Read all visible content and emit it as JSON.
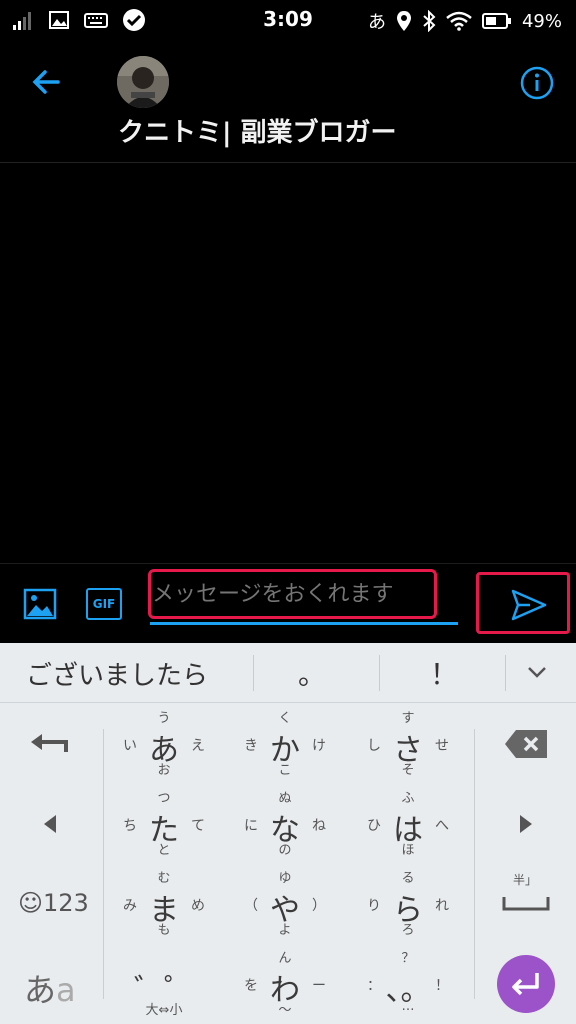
{
  "status": {
    "time": "3:09",
    "ime": "あ",
    "battery": "49%"
  },
  "header": {
    "title": "クニトミ| 副業ブロガー"
  },
  "composer": {
    "placeholder": "メッセージをおくれます",
    "gif_label": "GIF"
  },
  "keyboard": {
    "suggestion": "ございましたら",
    "suggest_items": [
      "。",
      "！"
    ],
    "rows": [
      [
        {
          "c": "あ",
          "u": "う",
          "d": "お",
          "l": "い",
          "r": "え"
        },
        {
          "c": "か",
          "u": "く",
          "d": "こ",
          "l": "き",
          "r": "け"
        },
        {
          "c": "さ",
          "u": "す",
          "d": "そ",
          "l": "し",
          "r": "せ"
        }
      ],
      [
        {
          "c": "た",
          "u": "つ",
          "d": "と",
          "l": "ち",
          "r": "て"
        },
        {
          "c": "な",
          "u": "ぬ",
          "d": "の",
          "l": "に",
          "r": "ね"
        },
        {
          "c": "は",
          "u": "ふ",
          "d": "ほ",
          "l": "ひ",
          "r": "へ"
        }
      ],
      [
        {
          "c": "ま",
          "u": "む",
          "d": "も",
          "l": "み",
          "r": "め"
        },
        {
          "c": "や",
          "u": "ゆ",
          "d": "よ",
          "l": "（",
          "r": "）"
        },
        {
          "c": "ら",
          "u": "る",
          "d": "ろ",
          "l": "り",
          "r": "れ"
        }
      ],
      [
        {
          "c": "゛゜",
          "u": "",
          "d": "大⇔小",
          "l": "",
          "r": ""
        },
        {
          "c": "わ",
          "u": "ん",
          "d": "〜",
          "l": "を",
          "r": "ー"
        },
        {
          "c": "、。",
          "u": "？",
          "d": "…",
          "l": "：",
          "r": "！"
        }
      ]
    ],
    "emoji_num": "☺123",
    "mode_a": "あ",
    "mode_b": "a",
    "space_hint": "半」"
  }
}
